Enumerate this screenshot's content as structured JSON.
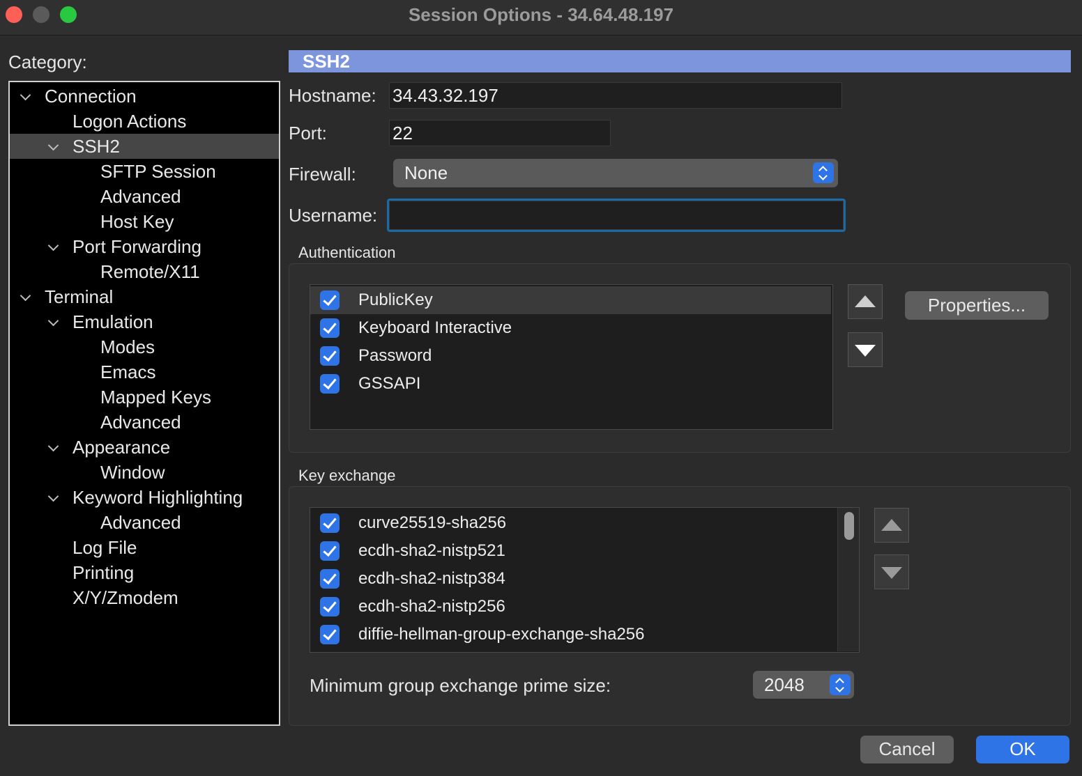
{
  "window": {
    "title": "Session Options - 34.64.48.197"
  },
  "category": {
    "label": "Category:",
    "items": [
      {
        "label": "Connection",
        "level": 0,
        "expandable": true
      },
      {
        "label": "Logon Actions",
        "level": 1,
        "expandable": false
      },
      {
        "label": "SSH2",
        "level": 1,
        "expandable": true,
        "selected": true
      },
      {
        "label": "SFTP Session",
        "level": 2,
        "expandable": false
      },
      {
        "label": "Advanced",
        "level": 2,
        "expandable": false
      },
      {
        "label": "Host Key",
        "level": 2,
        "expandable": false
      },
      {
        "label": "Port Forwarding",
        "level": 1,
        "expandable": true
      },
      {
        "label": "Remote/X11",
        "level": 2,
        "expandable": false
      },
      {
        "label": "Terminal",
        "level": 0,
        "expandable": true
      },
      {
        "label": "Emulation",
        "level": 1,
        "expandable": true
      },
      {
        "label": "Modes",
        "level": 2,
        "expandable": false
      },
      {
        "label": "Emacs",
        "level": 2,
        "expandable": false
      },
      {
        "label": "Mapped Keys",
        "level": 2,
        "expandable": false
      },
      {
        "label": "Advanced",
        "level": 2,
        "expandable": false
      },
      {
        "label": "Appearance",
        "level": 1,
        "expandable": true
      },
      {
        "label": "Window",
        "level": 2,
        "expandable": false
      },
      {
        "label": "Keyword Highlighting",
        "level": 1,
        "expandable": true
      },
      {
        "label": "Advanced",
        "level": 2,
        "expandable": false
      },
      {
        "label": "Log File",
        "level": 1,
        "expandable": false
      },
      {
        "label": "Printing",
        "level": 1,
        "expandable": false
      },
      {
        "label": "X/Y/Zmodem",
        "level": 1,
        "expandable": false
      }
    ]
  },
  "panel": {
    "header": "SSH2",
    "hostname": {
      "label": "Hostname:",
      "value": "34.43.32.197"
    },
    "port": {
      "label": "Port:",
      "value": "22"
    },
    "firewall": {
      "label": "Firewall:",
      "value": "None"
    },
    "username": {
      "label": "Username:",
      "value": ""
    }
  },
  "authentication": {
    "label": "Authentication",
    "methods": [
      {
        "label": "PublicKey",
        "checked": true,
        "selected": true
      },
      {
        "label": "Keyboard Interactive",
        "checked": true
      },
      {
        "label": "Password",
        "checked": true
      },
      {
        "label": "GSSAPI",
        "checked": true
      }
    ],
    "properties_label": "Properties..."
  },
  "key_exchange": {
    "label": "Key exchange",
    "items": [
      {
        "label": "curve25519-sha256",
        "checked": true
      },
      {
        "label": "ecdh-sha2-nistp521",
        "checked": true
      },
      {
        "label": "ecdh-sha2-nistp384",
        "checked": true
      },
      {
        "label": "ecdh-sha2-nistp256",
        "checked": true
      },
      {
        "label": "diffie-hellman-group-exchange-sha256",
        "checked": true
      }
    ],
    "prime_size_label": "Minimum group exchange prime size:",
    "prime_size_value": "2048"
  },
  "buttons": {
    "cancel": "Cancel",
    "ok": "OK"
  },
  "colors": {
    "accent": "#2f74e6",
    "header": "#7c95dd",
    "focus": "#1b6aa6"
  }
}
